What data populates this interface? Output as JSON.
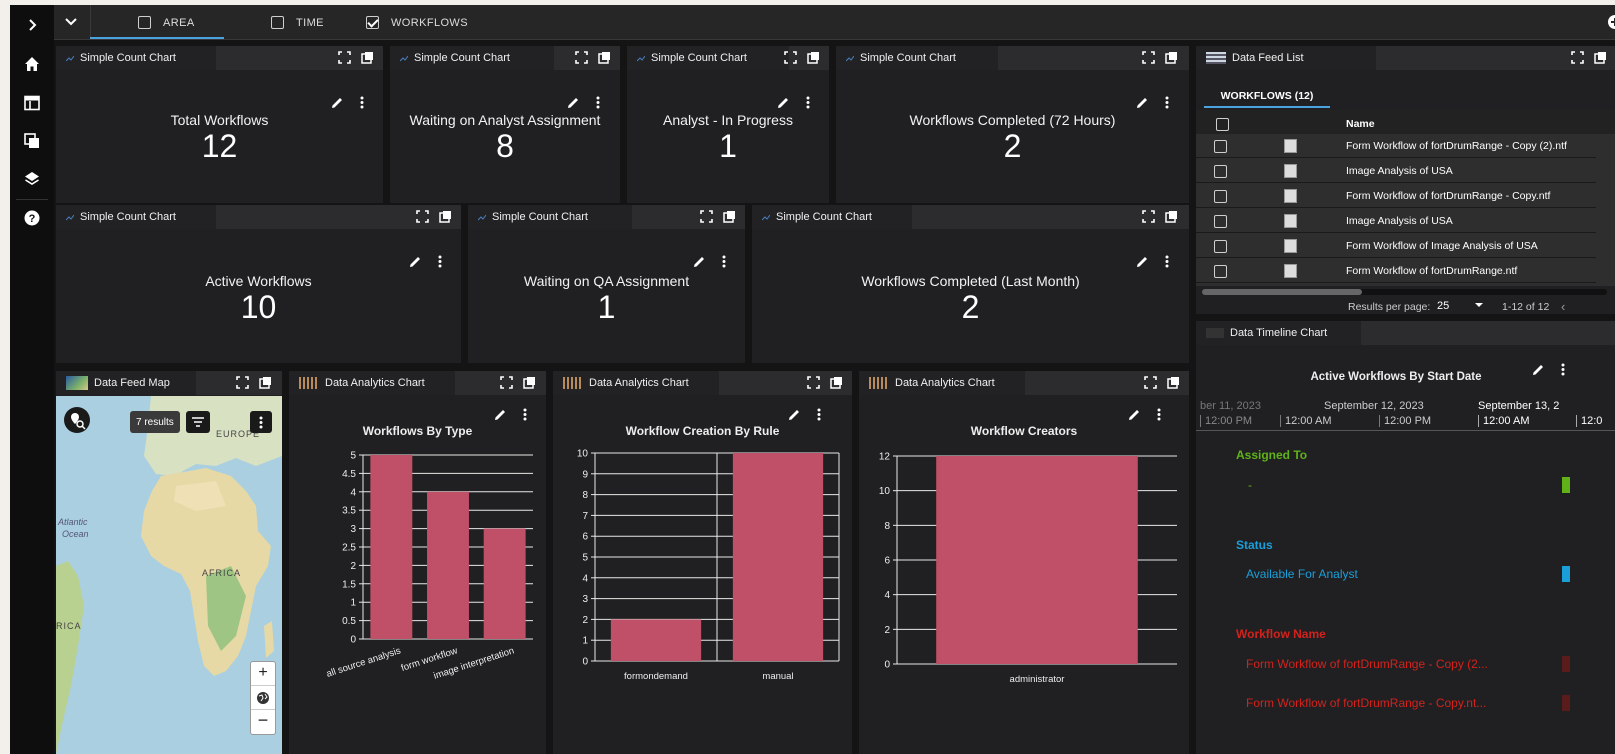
{
  "topbar": {
    "tabs": [
      {
        "label": "AREA",
        "checked": false
      },
      {
        "label": "TIME",
        "checked": false
      },
      {
        "label": "WORKFLOWS",
        "checked": true
      }
    ]
  },
  "rail": {
    "icons": [
      "chevron-right-icon",
      "home-icon",
      "dashboard-icon",
      "copy-icon",
      "layers-icon",
      "help-icon"
    ]
  },
  "count_panels": [
    {
      "header": "Simple Count Chart",
      "title": "Total Workflows",
      "value": "12"
    },
    {
      "header": "Simple Count Chart",
      "title": "Waiting on Analyst Assignment",
      "value": "8"
    },
    {
      "header": "Simple Count Chart",
      "title": "Analyst - In Progress",
      "value": "1"
    },
    {
      "header": "Simple Count Chart",
      "title": "Workflows Completed (72 Hours)",
      "value": "2"
    },
    {
      "header": "Simple Count Chart",
      "title": "Active Workflows",
      "value": "10"
    },
    {
      "header": "Simple Count Chart",
      "title": "Waiting on QA Assignment",
      "value": "1"
    },
    {
      "header": "Simple Count Chart",
      "title": "Workflows Completed (Last Month)",
      "value": "2"
    }
  ],
  "map": {
    "header": "Data Feed Map",
    "results": "7 results",
    "labels": {
      "atlantic": "Atlantic",
      "ocean": "Ocean",
      "africa": "AFRICA",
      "rica": "RICA",
      "europe": "EUROPE"
    }
  },
  "analytics_header": "Data Analytics Chart",
  "chart_data": [
    {
      "type": "bar",
      "title": "Workflows By Type",
      "categories": [
        "all source analysis",
        "form workflow",
        "image interpretation"
      ],
      "values": [
        5,
        4,
        3
      ],
      "ylim": [
        0,
        5
      ],
      "yticks": [
        "0",
        "0.5",
        "1",
        "1.5",
        "2",
        "2.5",
        "3",
        "3.5",
        "4",
        "4.5",
        "5"
      ],
      "color": "#c05068"
    },
    {
      "type": "bar",
      "title": "Workflow Creation By Rule",
      "categories": [
        "formondemand",
        "manual"
      ],
      "values": [
        2,
        10
      ],
      "ylim": [
        0,
        10
      ],
      "yticks": [
        "0",
        "1",
        "2",
        "3",
        "4",
        "5",
        "6",
        "7",
        "8",
        "9",
        "10"
      ],
      "color": "#c05068"
    },
    {
      "type": "bar",
      "title": "Workflow Creators",
      "categories": [
        "administrator"
      ],
      "values": [
        12
      ],
      "ylim": [
        0,
        12
      ],
      "yticks": [
        "0",
        "2",
        "4",
        "6",
        "8",
        "10",
        "12"
      ],
      "color": "#c05068"
    }
  ],
  "feed_list": {
    "header": "Data Feed List",
    "tab": "WORKFLOWS (12)",
    "column_name": "Name",
    "rows": [
      "Form Workflow of fortDrumRange - Copy (2).ntf",
      "Image Analysis of USA",
      "Form Workflow of fortDrumRange - Copy.ntf",
      "Image Analysis of USA",
      "Form Workflow of Image Analysis of USA",
      "Form Workflow of fortDrumRange.ntf"
    ],
    "results_per_page_label": "Results per page:",
    "results_per_page": "25",
    "range": "1-12 of 12"
  },
  "timeline": {
    "header": "Data Timeline Chart",
    "title": "Active Workflows By Start Date",
    "dates": [
      "ber 11, 2023",
      "September 12, 2023",
      "September 13, 2"
    ],
    "times": [
      "12:00 PM",
      "12:00 AM",
      "12:00 PM",
      "12:00 AM",
      "12:0"
    ],
    "groups": [
      {
        "label": "Assigned To",
        "color": "#5fb319",
        "values": [
          "-"
        ]
      },
      {
        "label": "Status",
        "color": "#1a9fd9",
        "values": [
          "Available For Analyst"
        ]
      },
      {
        "label": "Workflow Name",
        "color": "#d3221c",
        "values": [
          "Form Workflow of fortDrumRange - Copy (2...",
          "Form Workflow of fortDrumRange - Copy.nt..."
        ]
      }
    ]
  }
}
